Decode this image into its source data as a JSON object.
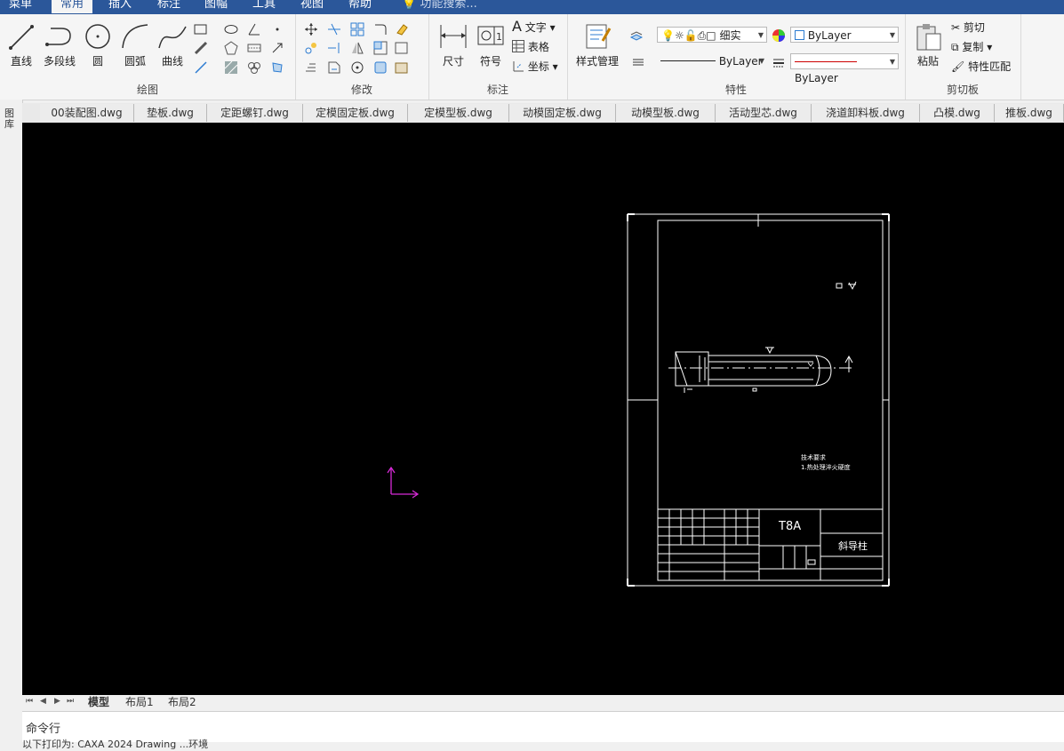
{
  "menu": {
    "items": [
      "菜单",
      "常用",
      "插入",
      "标注",
      "图幅",
      "工具",
      "视图",
      "帮助"
    ],
    "active": "常用",
    "search_placeholder": "功能搜索..."
  },
  "ribbon": {
    "draw": {
      "title": "绘图",
      "line": "直线",
      "polyline": "多段线",
      "circle": "圆",
      "arc": "圆弧",
      "curve": "曲线"
    },
    "modify": {
      "title": "修改"
    },
    "annotate": {
      "title": "标注",
      "dimension": "尺寸",
      "symbol": "符号",
      "text": "文字",
      "table": "表格",
      "coordinate": "坐标"
    },
    "properties": {
      "title": "特性",
      "style_manager": "样式管理",
      "layer_fine": "细实",
      "color_value": "ByLayer",
      "linetype_value": "ByLayer",
      "lineweight_value": "ByLayer"
    },
    "clipboard": {
      "title": "剪切板",
      "paste": "粘贴",
      "cut": "剪切",
      "copy": "复制",
      "match": "特性匹配"
    }
  },
  "left_strip": {
    "label": "图库"
  },
  "doc_tabs": [
    "00装配图.dwg",
    "垫板.dwg",
    "定距螺钉.dwg",
    "定模固定板.dwg",
    "定模型板.dwg",
    "动模固定板.dwg",
    "动模型板.dwg",
    "活动型芯.dwg",
    "浇道卸料板.dwg",
    "凸模.dwg",
    "推板.dwg"
  ],
  "drawing": {
    "material": "T8A",
    "part_name": "斜导柱",
    "tech_req_title": "技术要求",
    "tech_req_line": "1.热处理淬火硬度"
  },
  "layout_tabs": {
    "model": "模型",
    "layout1": "布局1",
    "layout2": "布局2"
  },
  "command": {
    "label": "命令行",
    "history": "以下打印为: CAXA 2024 Drawing ...环境"
  },
  "colors": {
    "accent": "#2b579a",
    "ucs": "#d62ad6",
    "canvas_bg": "#000000"
  }
}
